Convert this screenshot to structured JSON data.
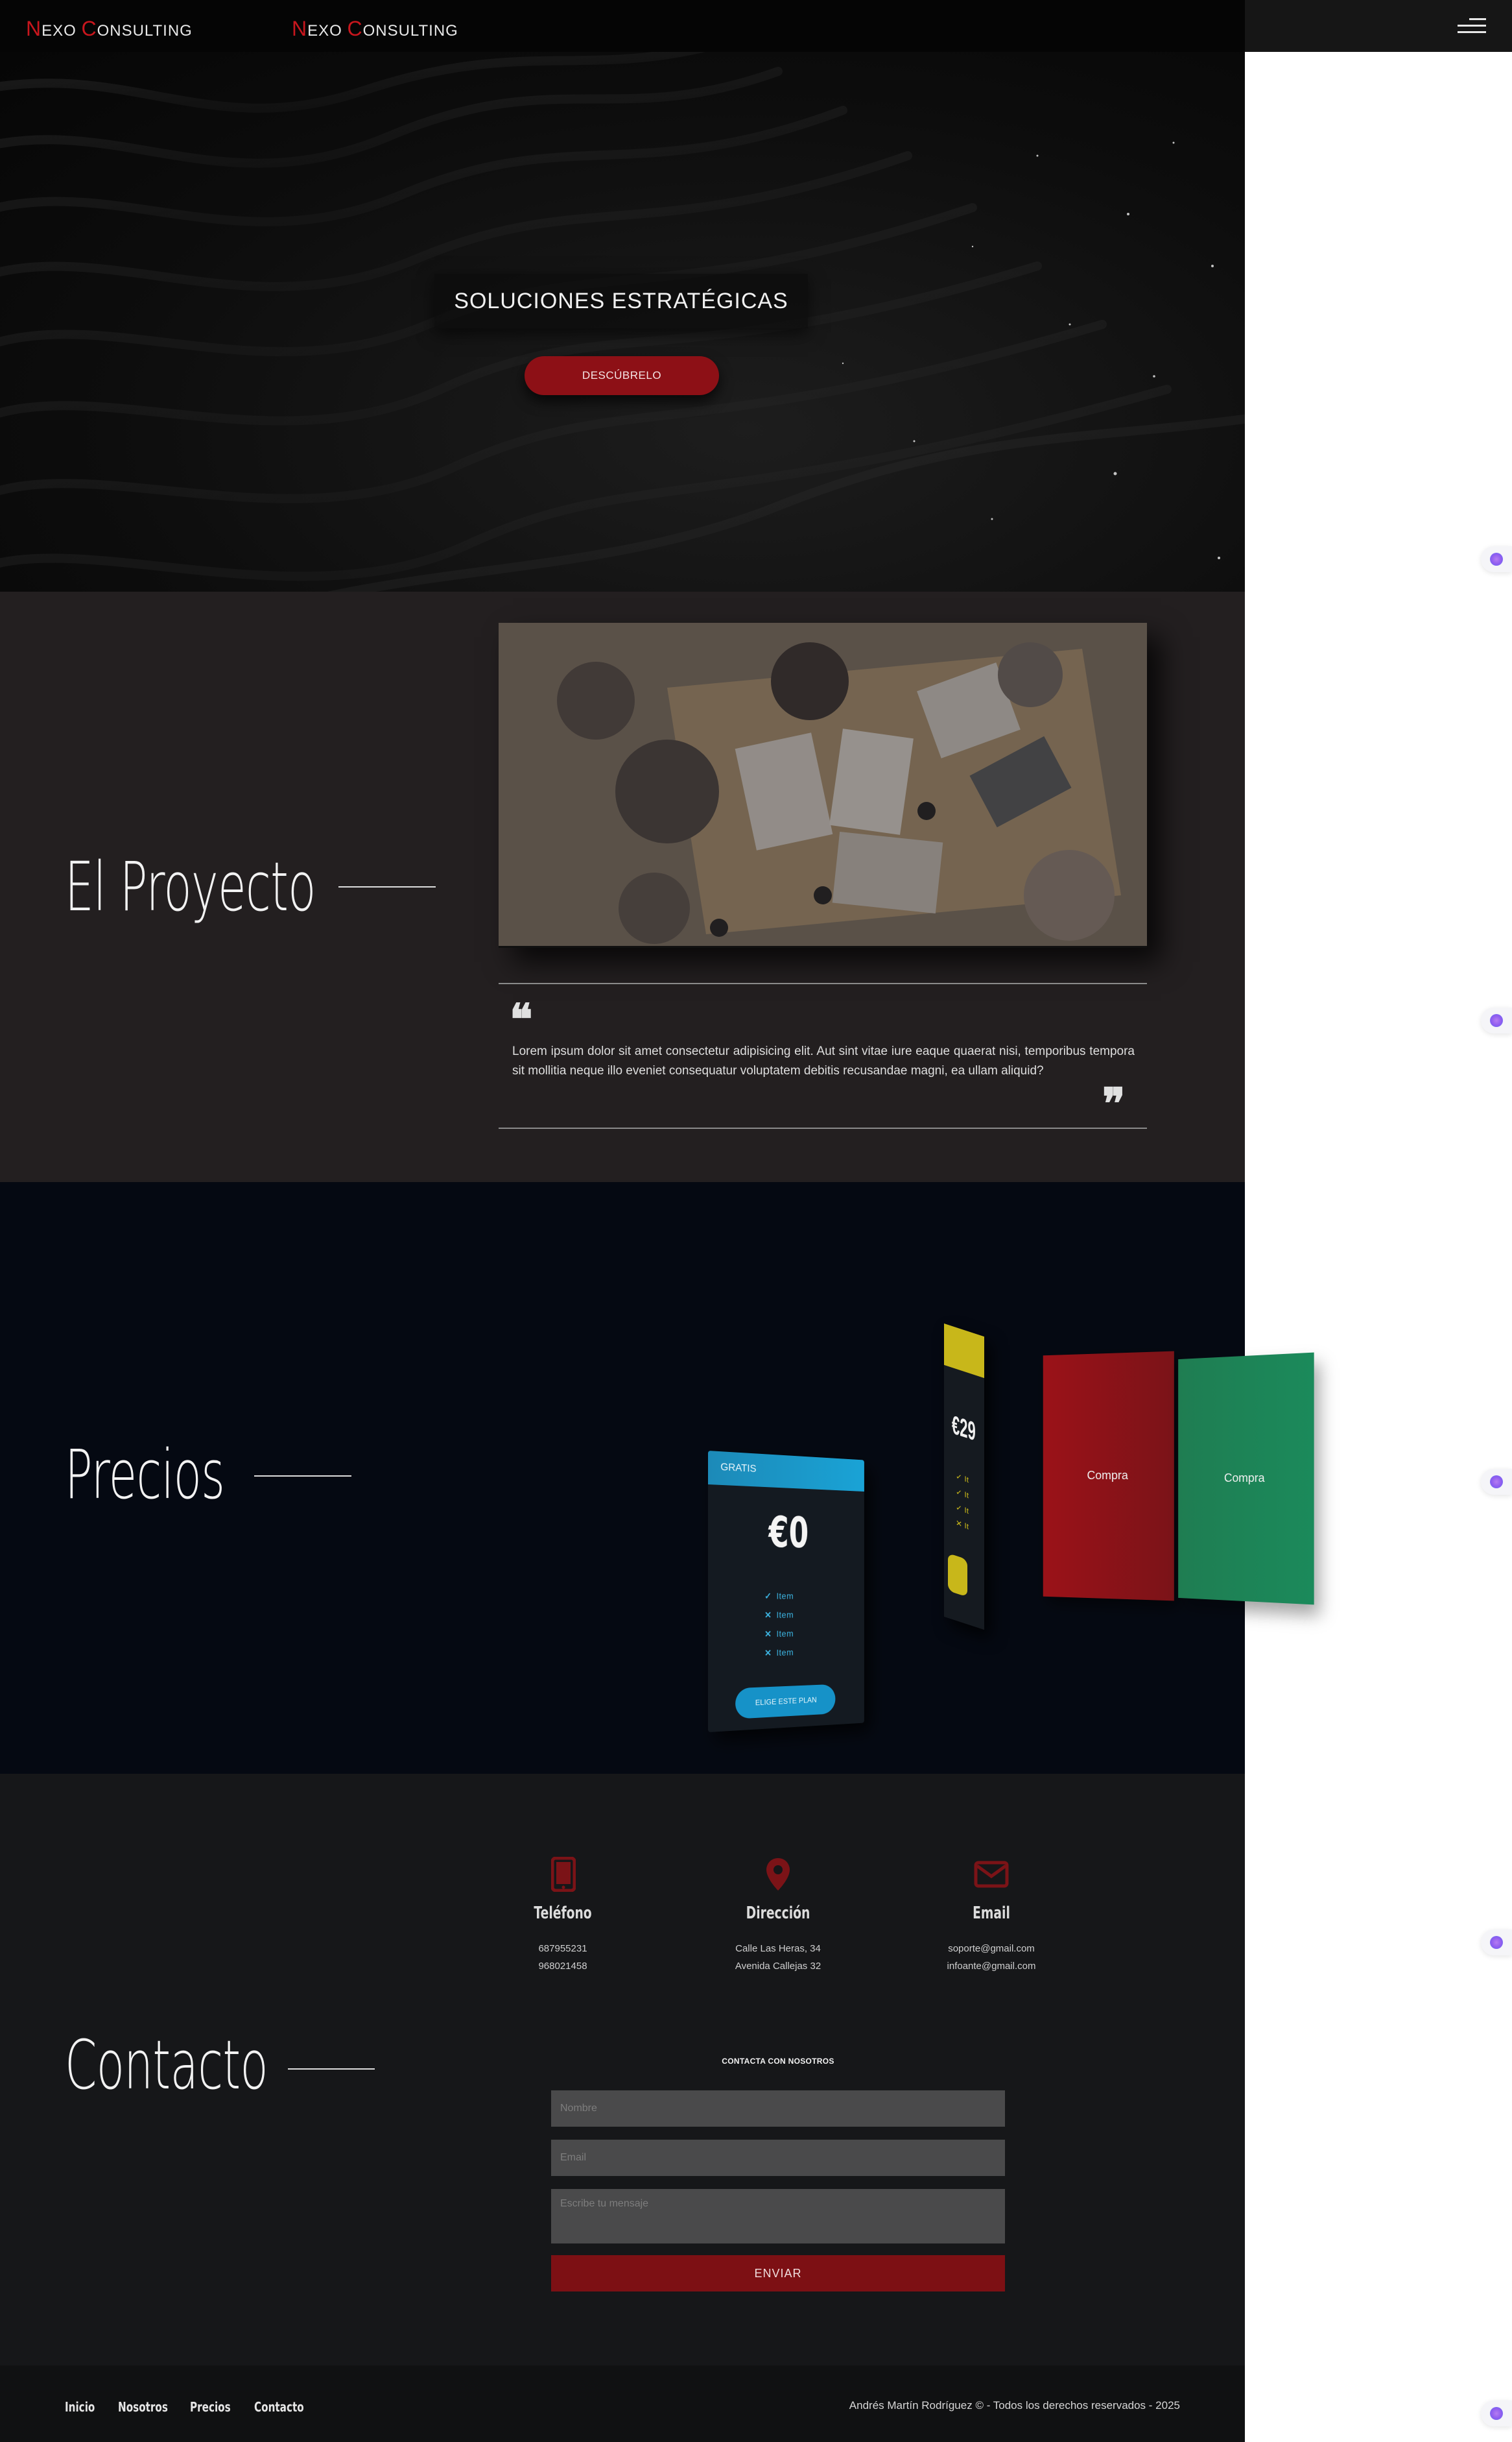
{
  "navbar": {
    "brand_1": {
      "cap_n": "N",
      "rest_n": "EXO ",
      "cap_c": "C",
      "rest_c": "ONSULTING"
    },
    "brand_2": {
      "cap_n": "N",
      "rest_n": "EXO ",
      "cap_c": "C",
      "rest_c": "ONSULTING"
    },
    "menu_icon": "hamburger-icon"
  },
  "hero": {
    "title": "SOLUCIONES ESTRATÉGICAS",
    "button": "DESCÚBRELO"
  },
  "project": {
    "heading": "El Proyecto",
    "quote": "Lorem ipsum dolor sit amet consectetur adipisicing elit. Aut sint vitae iure eaque quaerat nisi, temporibus tempora sit mollitia neque illo eveniet consequatur voluptatem debitis recusandae magni, ea ullam aliquid?",
    "open_quote": "❝",
    "close_quote": "❞"
  },
  "pricing": {
    "heading": "Precios",
    "free_plan": {
      "label": "GRATIS",
      "price": "€0",
      "items": [
        {
          "icon": "✓",
          "text": "Item"
        },
        {
          "icon": "✕",
          "text": "Item"
        },
        {
          "icon": "✕",
          "text": "Item"
        },
        {
          "icon": "✕",
          "text": "Item"
        }
      ],
      "button": "ELIGE ESTE PLAN"
    },
    "mid_plan": {
      "price": "€29",
      "items": [
        "✓ It",
        "✓ It",
        "✓ It",
        "✕ It"
      ]
    },
    "red_card": {
      "label": "Compra"
    },
    "green_card": {
      "label": "Compra"
    }
  },
  "contact": {
    "heading": "Contacto",
    "phone": {
      "title": "Teléfono",
      "lines": [
        "687955231",
        "968021458"
      ]
    },
    "address": {
      "title": "Dirección",
      "lines": [
        "Calle Las Heras, 34",
        "Avenida Callejas 32"
      ]
    },
    "email": {
      "title": "Email",
      "lines": [
        "soporte@gmail.com",
        "infoante@gmail.com"
      ]
    },
    "form": {
      "title": "CONTACTA CON NOSOTROS",
      "name_placeholder": "Nombre",
      "email_placeholder": "Email",
      "message_placeholder": "Escribe tu mensaje",
      "submit": "ENVIAR"
    }
  },
  "footer": {
    "links": [
      "Inicio",
      "Nosotros",
      "Precios",
      "Contacto"
    ],
    "copyright": "Andrés Martín Rodríguez © - Todos los derechos reservados - 2025"
  },
  "colors": {
    "accent_red": "#8d1016",
    "free_blue": "#1aa3d6",
    "mid_yellow": "#c8b71a",
    "green": "#1f7d52",
    "contact_icon_red": "#7b1317"
  }
}
